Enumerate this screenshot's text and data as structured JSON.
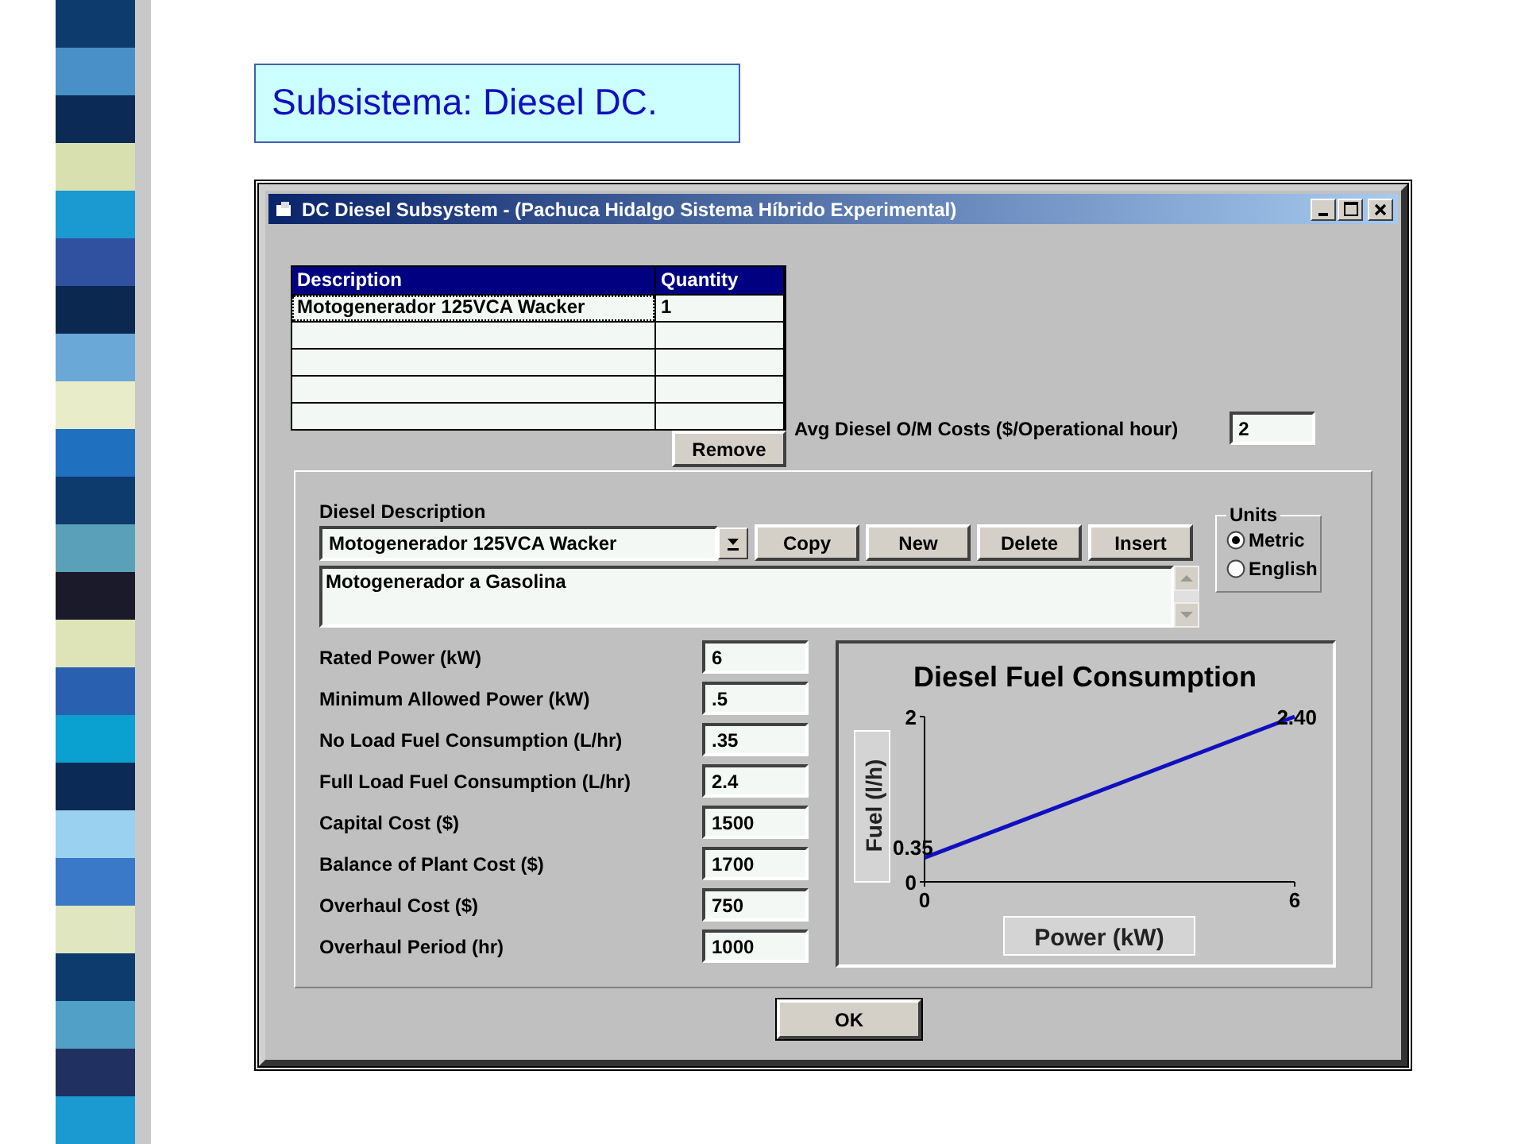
{
  "slide_title": "Subsistema: Diesel DC.",
  "window": {
    "title": "DC Diesel Subsystem - (Pachuca Hidalgo Sistema Híbrido Experimental)"
  },
  "components_table": {
    "columns": [
      "Description",
      "Quantity"
    ],
    "rows": [
      {
        "description": "Motogenerador 125VCA Wacker",
        "quantity": "1"
      }
    ],
    "remove_button": "Remove"
  },
  "om_costs": {
    "label": "Avg Diesel O/M Costs ($/Operational hour)",
    "value": "2"
  },
  "diesel_description": {
    "label": "Diesel Description",
    "value": "Motogenerador 125VCA Wacker",
    "buttons": [
      "Copy",
      "New",
      "Delete",
      "Insert"
    ],
    "notes": "Motogenerador a Gasolina"
  },
  "units": {
    "title": "Units",
    "options": [
      {
        "label": "Metric",
        "selected": true
      },
      {
        "label": "English",
        "selected": false
      }
    ]
  },
  "parameters": [
    {
      "label": "Rated Power (kW)",
      "value": "6"
    },
    {
      "label": "Minimum Allowed Power (kW)",
      "value": ".5"
    },
    {
      "label": "No Load Fuel Consumption (L/hr)",
      "value": ".35"
    },
    {
      "label": "Full Load Fuel Consumption (L/hr)",
      "value": "2.4"
    },
    {
      "label": "Capital Cost ($)",
      "value": "1500"
    },
    {
      "label": "Balance of Plant Cost ($)",
      "value": "1700"
    },
    {
      "label": "Overhaul Cost ($)",
      "value": "750"
    },
    {
      "label": "Overhaul Period (hr)",
      "value": "1000"
    }
  ],
  "chart": {
    "chart_data": {
      "type": "line",
      "title": "Diesel Fuel Consumption",
      "xlabel": "Power (kW)",
      "ylabel": "Fuel (l/h)",
      "x": [
        0,
        6
      ],
      "series": [
        {
          "color": "#1010c0",
          "values": [
            0.35,
            2.4
          ]
        }
      ],
      "xlim": [
        0,
        6
      ],
      "ylim": [
        0,
        2.4
      ],
      "xticks": [
        0,
        6
      ],
      "yticks": [
        0,
        {
          "value": 2.4,
          "label": "2"
        }
      ],
      "value_labels": [
        "0.35",
        "2.40"
      ]
    }
  },
  "ok_button": "OK"
}
